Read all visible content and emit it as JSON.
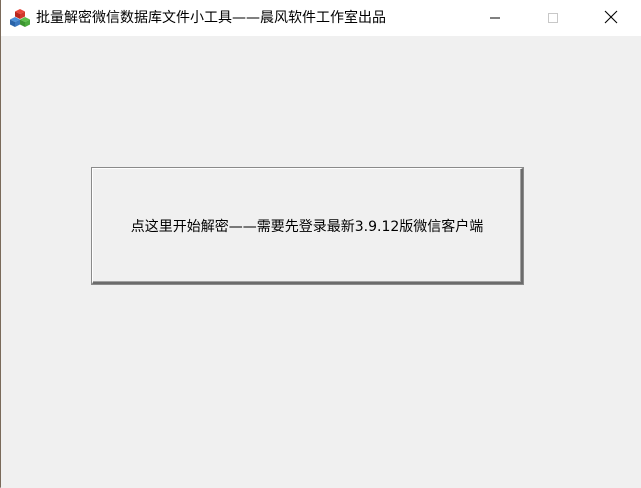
{
  "window": {
    "title": "批量解密微信数据库文件小工具——晨风软件工作室出品"
  },
  "main": {
    "decrypt_button_label": "点这里开始解密——需要先登录最新3.9.12版微信客户端"
  },
  "icons": {
    "app": "app-cubes-icon",
    "minimize": "minimize-icon",
    "maximize": "maximize-icon",
    "close": "close-icon"
  }
}
